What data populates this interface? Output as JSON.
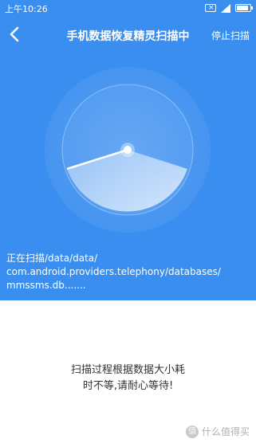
{
  "status_bar": {
    "time": "上午10:26"
  },
  "header": {
    "title": "手机数据恢复精灵扫描中",
    "stop_label": "停止扫描"
  },
  "scan": {
    "path_line1": "正在扫描/data/data/",
    "path_line2": "com.android.providers.telephony/databases/",
    "path_line3": "mmssms.db......."
  },
  "hint": {
    "line1": "扫描过程根据数据大小耗",
    "line2": "时不等,请耐心等待!"
  },
  "watermark": {
    "text": "什么值得买"
  },
  "colors": {
    "primary": "#3a8ef0",
    "text_dark": "#333333"
  },
  "icons": {
    "back": "back-arrow-icon",
    "mail": "mail-icon",
    "signal": "signal-icon",
    "battery": "battery-icon"
  }
}
